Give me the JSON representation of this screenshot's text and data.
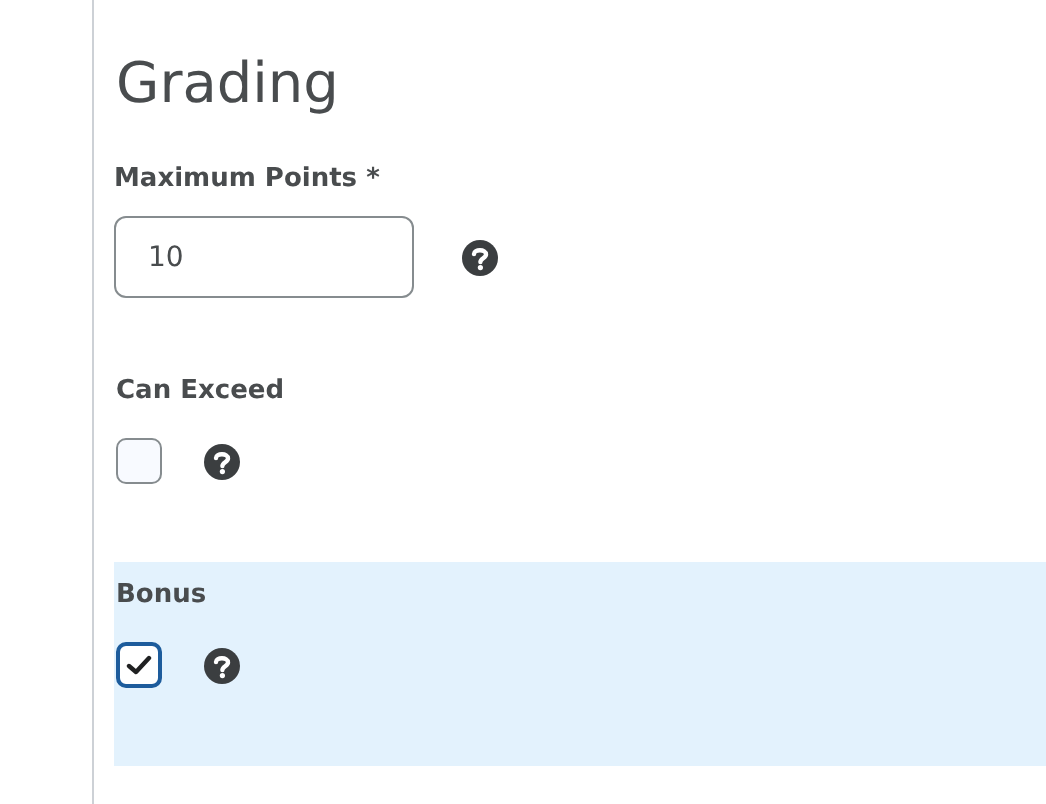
{
  "heading": "Grading",
  "max_points": {
    "label": "Maximum Points *",
    "value": "10"
  },
  "options": [
    {
      "label": "Can Exceed",
      "checked": false,
      "highlighted": false
    },
    {
      "label": "Bonus",
      "checked": true,
      "highlighted": true
    }
  ]
}
